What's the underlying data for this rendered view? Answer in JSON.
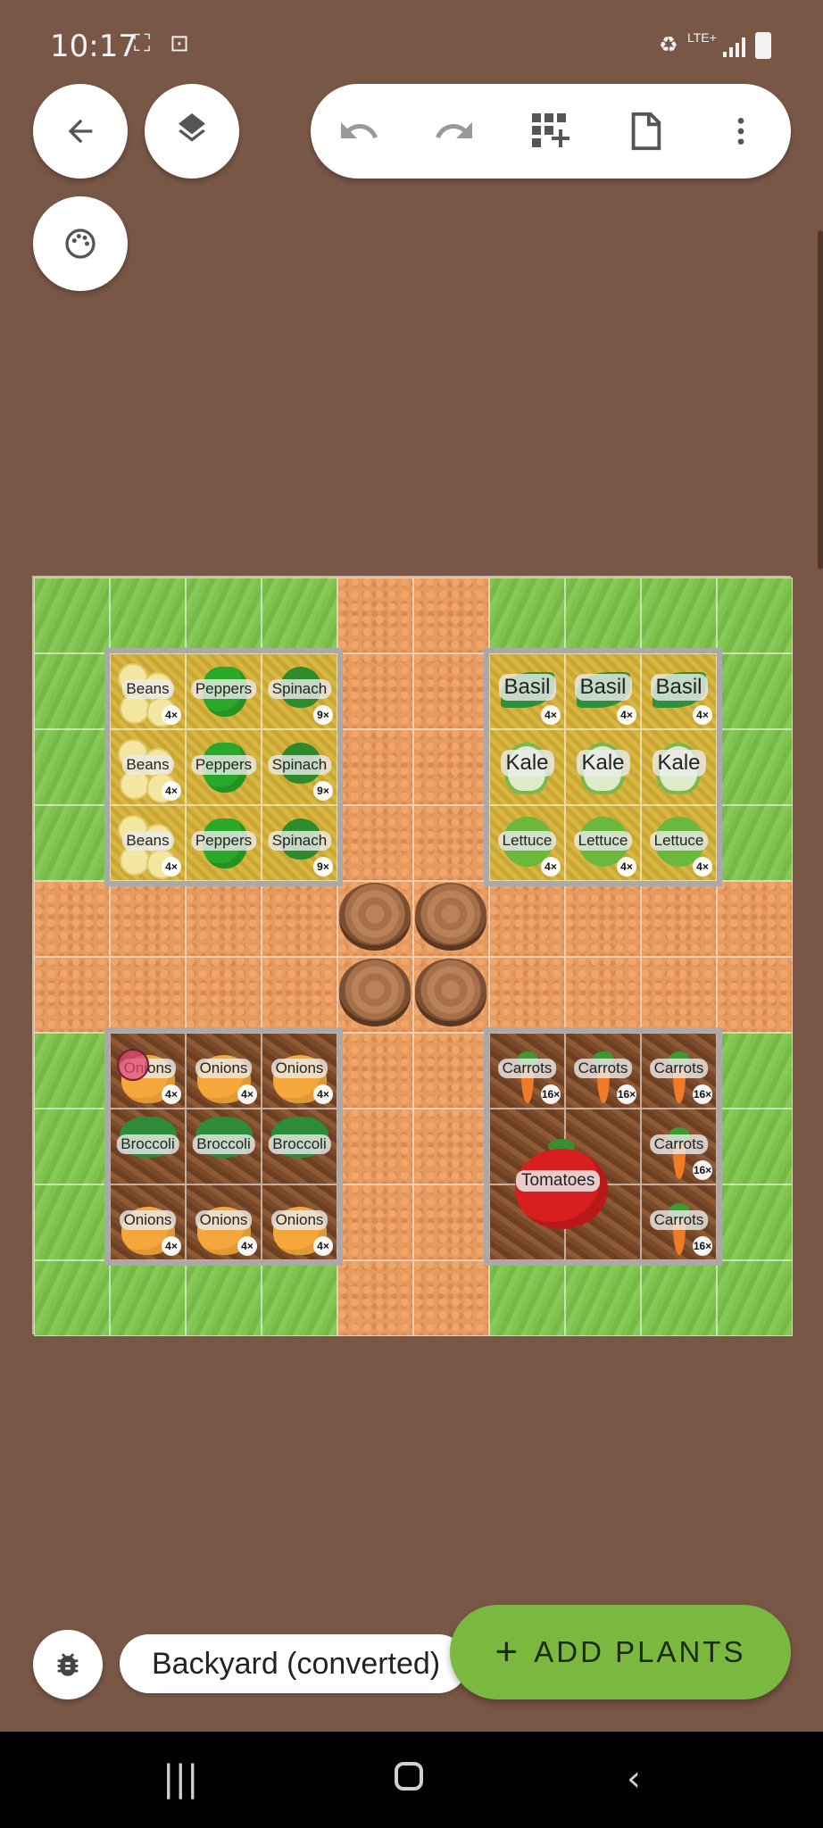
{
  "status_bar": {
    "time": "10:17",
    "network": "LTE+"
  },
  "toolbar": {
    "back": "back-arrow-icon",
    "layers": "layers-icon",
    "palette": "palette-icon",
    "undo": "undo-icon",
    "redo": "redo-icon",
    "add_grid": "add-grid-icon",
    "page": "page-icon",
    "more": "more-vert-icon"
  },
  "beds": {
    "top_left": [
      [
        {
          "name": "Beans",
          "count": "4×"
        },
        {
          "name": "Peppers",
          "count": ""
        },
        {
          "name": "Spinach",
          "count": "9×"
        }
      ],
      [
        {
          "name": "Beans",
          "count": "4×"
        },
        {
          "name": "Peppers",
          "count": ""
        },
        {
          "name": "Spinach",
          "count": "9×"
        }
      ],
      [
        {
          "name": "Beans",
          "count": "4×"
        },
        {
          "name": "Peppers",
          "count": ""
        },
        {
          "name": "Spinach",
          "count": "9×"
        }
      ]
    ],
    "top_right": [
      [
        {
          "name": "Basil",
          "count": "4×"
        },
        {
          "name": "Basil",
          "count": "4×"
        },
        {
          "name": "Basil",
          "count": "4×"
        }
      ],
      [
        {
          "name": "Kale",
          "count": ""
        },
        {
          "name": "Kale",
          "count": ""
        },
        {
          "name": "Kale",
          "count": ""
        }
      ],
      [
        {
          "name": "Lettuce",
          "count": "4×"
        },
        {
          "name": "Lettuce",
          "count": "4×"
        },
        {
          "name": "Lettuce",
          "count": "4×"
        }
      ]
    ],
    "bottom_left": [
      [
        {
          "name": "Onions",
          "count": "4×"
        },
        {
          "name": "Onions",
          "count": "4×"
        },
        {
          "name": "Onions",
          "count": "4×"
        }
      ],
      [
        {
          "name": "Broccoli",
          "count": ""
        },
        {
          "name": "Broccoli",
          "count": ""
        },
        {
          "name": "Broccoli",
          "count": ""
        }
      ],
      [
        {
          "name": "Onions",
          "count": "4×"
        },
        {
          "name": "Onions",
          "count": "4×"
        },
        {
          "name": "Onions",
          "count": "4×"
        }
      ]
    ],
    "bottom_right": {
      "carrots": [
        {
          "name": "Carrots",
          "count": "16×"
        },
        {
          "name": "Carrots",
          "count": "16×"
        },
        {
          "name": "Carrots",
          "count": "16×"
        },
        {
          "name": "Carrots",
          "count": "16×"
        },
        {
          "name": "Carrots",
          "count": "16×"
        }
      ],
      "tomatoes": "Tomatoes"
    }
  },
  "bottom_bar": {
    "garden_name": "Backyard (converted)",
    "add_plants_label": "ADD PLANTS",
    "add_plants_icon": "+"
  },
  "colors": {
    "background": "#785747",
    "accent_green": "#7ab840",
    "grass": "#7fc24e",
    "path": "#e79a5d"
  }
}
